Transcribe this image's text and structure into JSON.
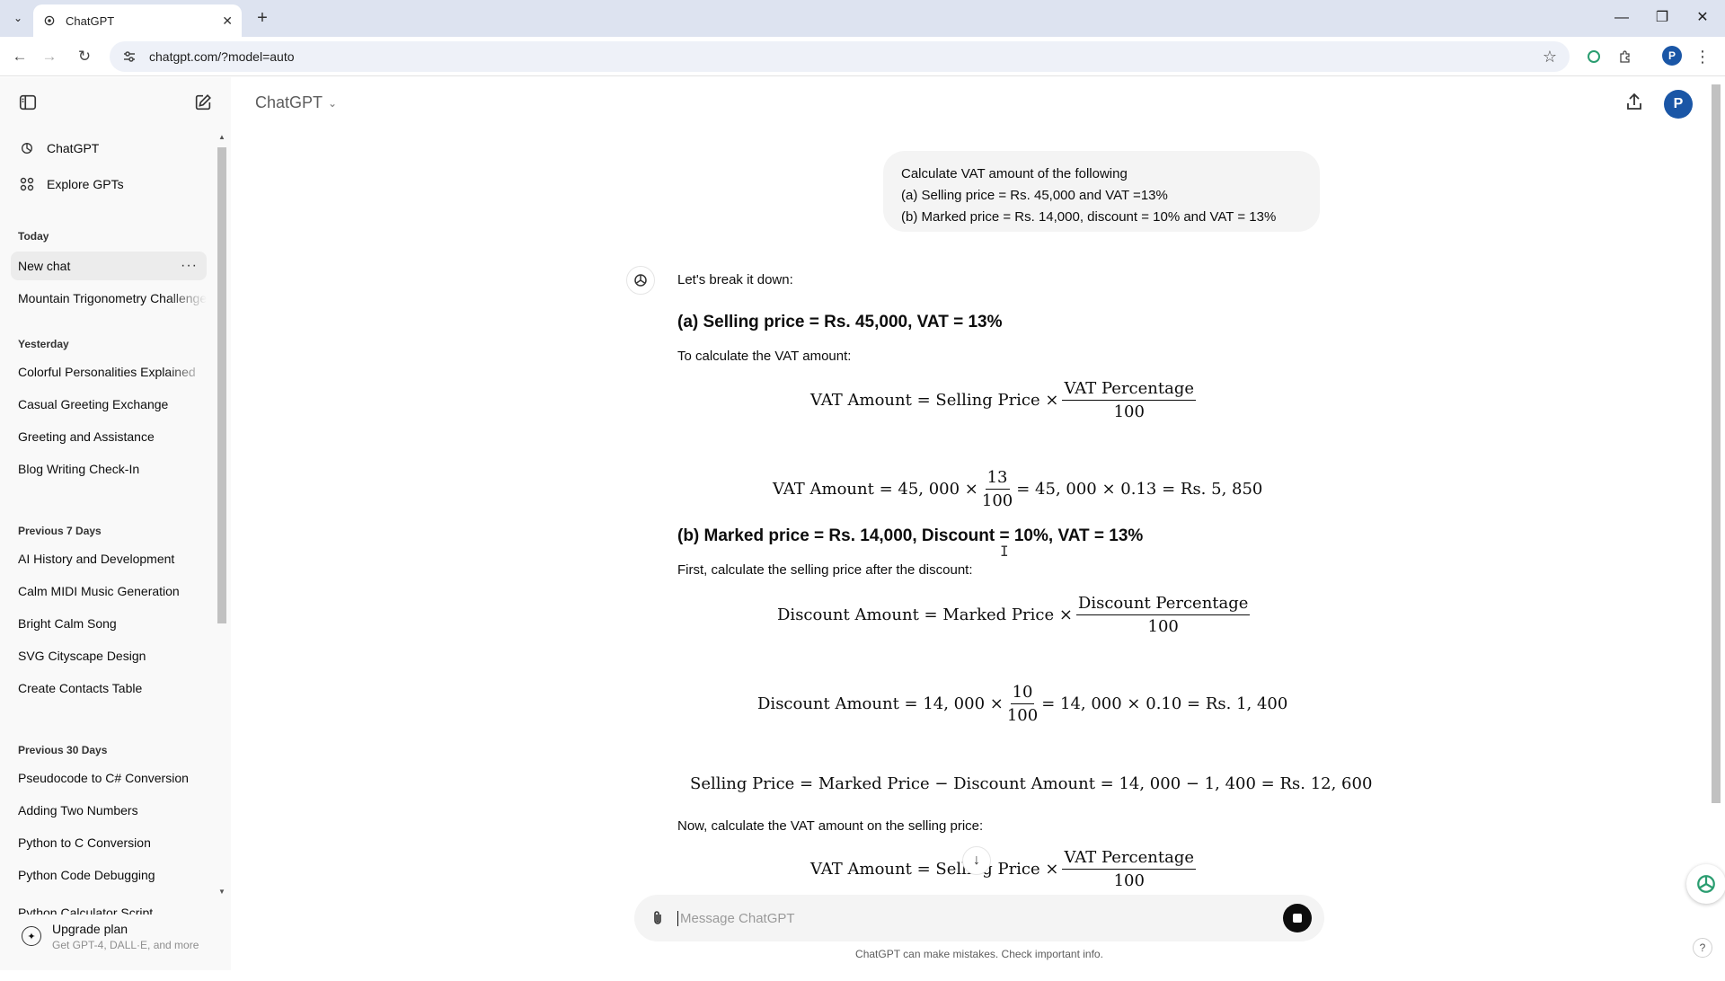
{
  "browser": {
    "tab_title": "ChatGPT",
    "tab_close": "✕",
    "new_tab": "+",
    "url": "chatgpt.com/?model=auto",
    "window_controls": {
      "minimize": "—",
      "restore": "❐",
      "close": "✕"
    },
    "profile_initial": "P"
  },
  "sidebar": {
    "top_items": [
      {
        "label": "ChatGPT",
        "icon": "chatgpt-logo-icon"
      },
      {
        "label": "Explore GPTs",
        "icon": "grid-icon"
      }
    ],
    "sections": [
      {
        "heading": "Today",
        "items": [
          "New chat",
          "Mountain Trigonometry Challenge"
        ]
      },
      {
        "heading": "Yesterday",
        "items": [
          "Colorful Personalities Explained",
          "Casual Greeting Exchange",
          "Greeting and Assistance",
          "Blog Writing Check-In"
        ]
      },
      {
        "heading": "Previous 7 Days",
        "items": [
          "AI History and Development",
          "Calm MIDI Music Generation",
          "Bright Calm Song",
          "SVG Cityscape Design",
          "Create Contacts Table"
        ]
      },
      {
        "heading": "Previous 30 Days",
        "items": [
          "Pseudocode to C# Conversion",
          "Adding Two Numbers",
          "Python to C Conversion",
          "Python Code Debugging",
          "Python Calculator Script"
        ]
      }
    ],
    "active_item_more": "···",
    "upgrade": {
      "title": "Upgrade plan",
      "subtitle": "Get GPT-4, DALL·E, and more"
    }
  },
  "header": {
    "model_label": "ChatGPT",
    "avatar_initial": "P"
  },
  "user_message": {
    "lines": [
      "Calculate VAT amount of the following",
      "(a) Selling price = Rs. 45,000 and VAT =13%",
      "(b) Marked price = Rs. 14,000, discount = 10% and VAT = 13%"
    ]
  },
  "assistant": {
    "intro": "Let's break it down:",
    "part_a": {
      "heading": "(a) Selling price = Rs. 45,000, VAT = 13%",
      "text": "To calculate the VAT amount:",
      "formula": {
        "lhs": "VAT Amount = Selling Price ×",
        "num": "VAT Percentage",
        "den": "100"
      },
      "calc": {
        "lhs": "VAT Amount = 45, 000 ×",
        "num": "13",
        "den": "100",
        "rhs": "= 45, 000 × 0.13 = Rs. 5, 850"
      }
    },
    "part_b": {
      "heading": "(b) Marked price = Rs. 14,000, Discount = 10%, VAT = 13%",
      "text": "First, calculate the selling price after the discount:",
      "formula": {
        "lhs": "Discount Amount = Marked Price ×",
        "num": "Discount Percentage",
        "den": "100"
      },
      "calc": {
        "lhs": "Discount Amount = 14, 000 ×",
        "num": "10",
        "den": "100",
        "rhs": "= 14, 000 × 0.10 = Rs. 1, 400"
      },
      "selling": "Selling Price = Marked Price − Discount Amount = 14, 000 − 1, 400 = Rs. 12, 600",
      "text2": "Now, calculate the VAT amount on the selling price:",
      "formula2": {
        "lhs": "VAT Amount = Selling Price ×",
        "num": "VAT Percentage",
        "den": "100"
      }
    }
  },
  "composer": {
    "placeholder": "Message ChatGPT",
    "disclaimer": "ChatGPT can make mistakes. Check important info."
  },
  "help_label": "?"
}
